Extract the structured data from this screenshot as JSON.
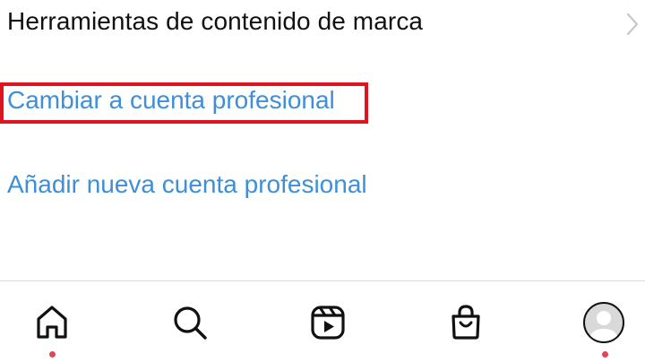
{
  "settings": {
    "brand_tools_label": "Herramientas de contenido de marca",
    "switch_professional_label": "Cambiar a cuenta profesional",
    "add_professional_label": "Añadir nueva cuenta profesional"
  },
  "bottom_nav": {
    "items": [
      {
        "name": "home",
        "icon": "home-icon",
        "has_dot": true
      },
      {
        "name": "search",
        "icon": "search-icon",
        "has_dot": false
      },
      {
        "name": "reels",
        "icon": "reels-icon",
        "has_dot": false
      },
      {
        "name": "shop",
        "icon": "shopping-bag-icon",
        "has_dot": false
      },
      {
        "name": "profile",
        "icon": "avatar",
        "has_dot": true
      }
    ]
  },
  "colors": {
    "link": "#3e8fd8",
    "text": "#111111",
    "highlight": "#e0141e",
    "notification_dot": "#e0465a"
  }
}
